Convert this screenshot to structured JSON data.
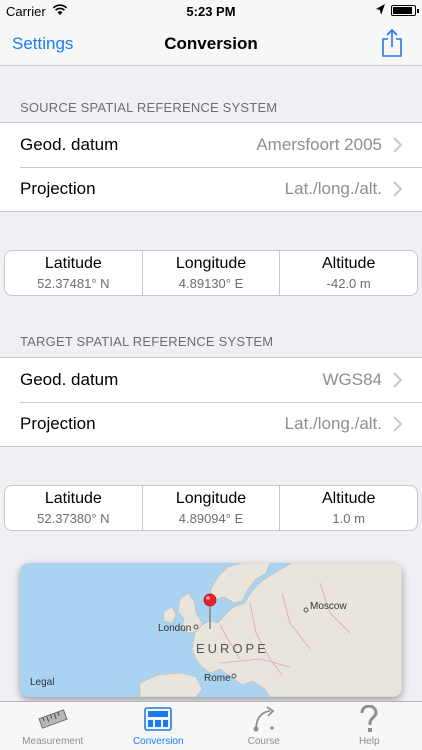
{
  "status_bar": {
    "carrier": "Carrier",
    "time": "5:23 PM",
    "battery_level": 0.9
  },
  "nav": {
    "left_button": "Settings",
    "title": "Conversion"
  },
  "source": {
    "header": "SOURCE SPATIAL REFERENCE SYSTEM",
    "rows": [
      {
        "label": "Geod. datum",
        "value": "Amersfoort 2005"
      },
      {
        "label": "Projection",
        "value": "Lat./long./alt."
      }
    ],
    "coords": [
      {
        "label": "Latitude",
        "value": "52.37481° N"
      },
      {
        "label": "Longitude",
        "value": "4.89130° E"
      },
      {
        "label": "Altitude",
        "value": "-42.0 m"
      }
    ]
  },
  "target": {
    "header": "TARGET SPATIAL REFERENCE SYSTEM",
    "rows": [
      {
        "label": "Geod. datum",
        "value": "WGS84"
      },
      {
        "label": "Projection",
        "value": "Lat./long./alt."
      }
    ],
    "coords": [
      {
        "label": "Latitude",
        "value": "52.37380° N"
      },
      {
        "label": "Longitude",
        "value": "4.89094° E"
      },
      {
        "label": "Altitude",
        "value": "1.0 m"
      }
    ]
  },
  "map": {
    "labels": {
      "moscow": "Moscow",
      "london": "London",
      "europe": "EUROPE",
      "rome": "Rome",
      "legal": "Legal"
    },
    "colors": {
      "water": "#a9d3f0",
      "land": "#e9e5dc",
      "pin": "#e8232a"
    }
  },
  "tabs": [
    {
      "label": "Measurement",
      "icon": "ruler-icon",
      "active": false
    },
    {
      "label": "Conversion",
      "icon": "conversion-icon",
      "active": true
    },
    {
      "label": "Course",
      "icon": "course-icon",
      "active": false
    },
    {
      "label": "Help",
      "icon": "help-icon",
      "active": false
    }
  ],
  "colors": {
    "accent": "#1a7cf3",
    "background": "#efeff4",
    "secondary_text": "#8e8e93"
  }
}
